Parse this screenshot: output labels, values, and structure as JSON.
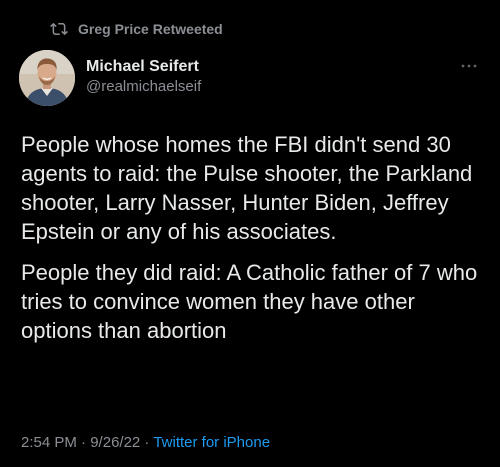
{
  "retweet": {
    "icon": "retweet-icon",
    "label": "Greg Price Retweeted"
  },
  "author": {
    "avatar_icon": "avatar",
    "name": "Michael Seifert",
    "handle": "@realmichaelseif"
  },
  "more_icon": "more-options-icon",
  "tweet": {
    "paragraphs": [
      "People whose homes the FBI didn't send 30 agents to raid: the Pulse shooter, the Parkland shooter, Larry Nasser, Hunter Biden, Jeffrey Epstein or any of his associates.",
      "People they did raid: A Catholic father of 7 who tries to convince women they have other options than abortion"
    ]
  },
  "meta": {
    "time": "2:54 PM",
    "separator1": " · ",
    "date": "9/26/22",
    "separator2": " · ",
    "source": "Twitter for iPhone"
  },
  "colors": {
    "background": "#000000",
    "text": "#e7e9ea",
    "muted": "#8b8f95",
    "link": "#1d9bf0"
  }
}
